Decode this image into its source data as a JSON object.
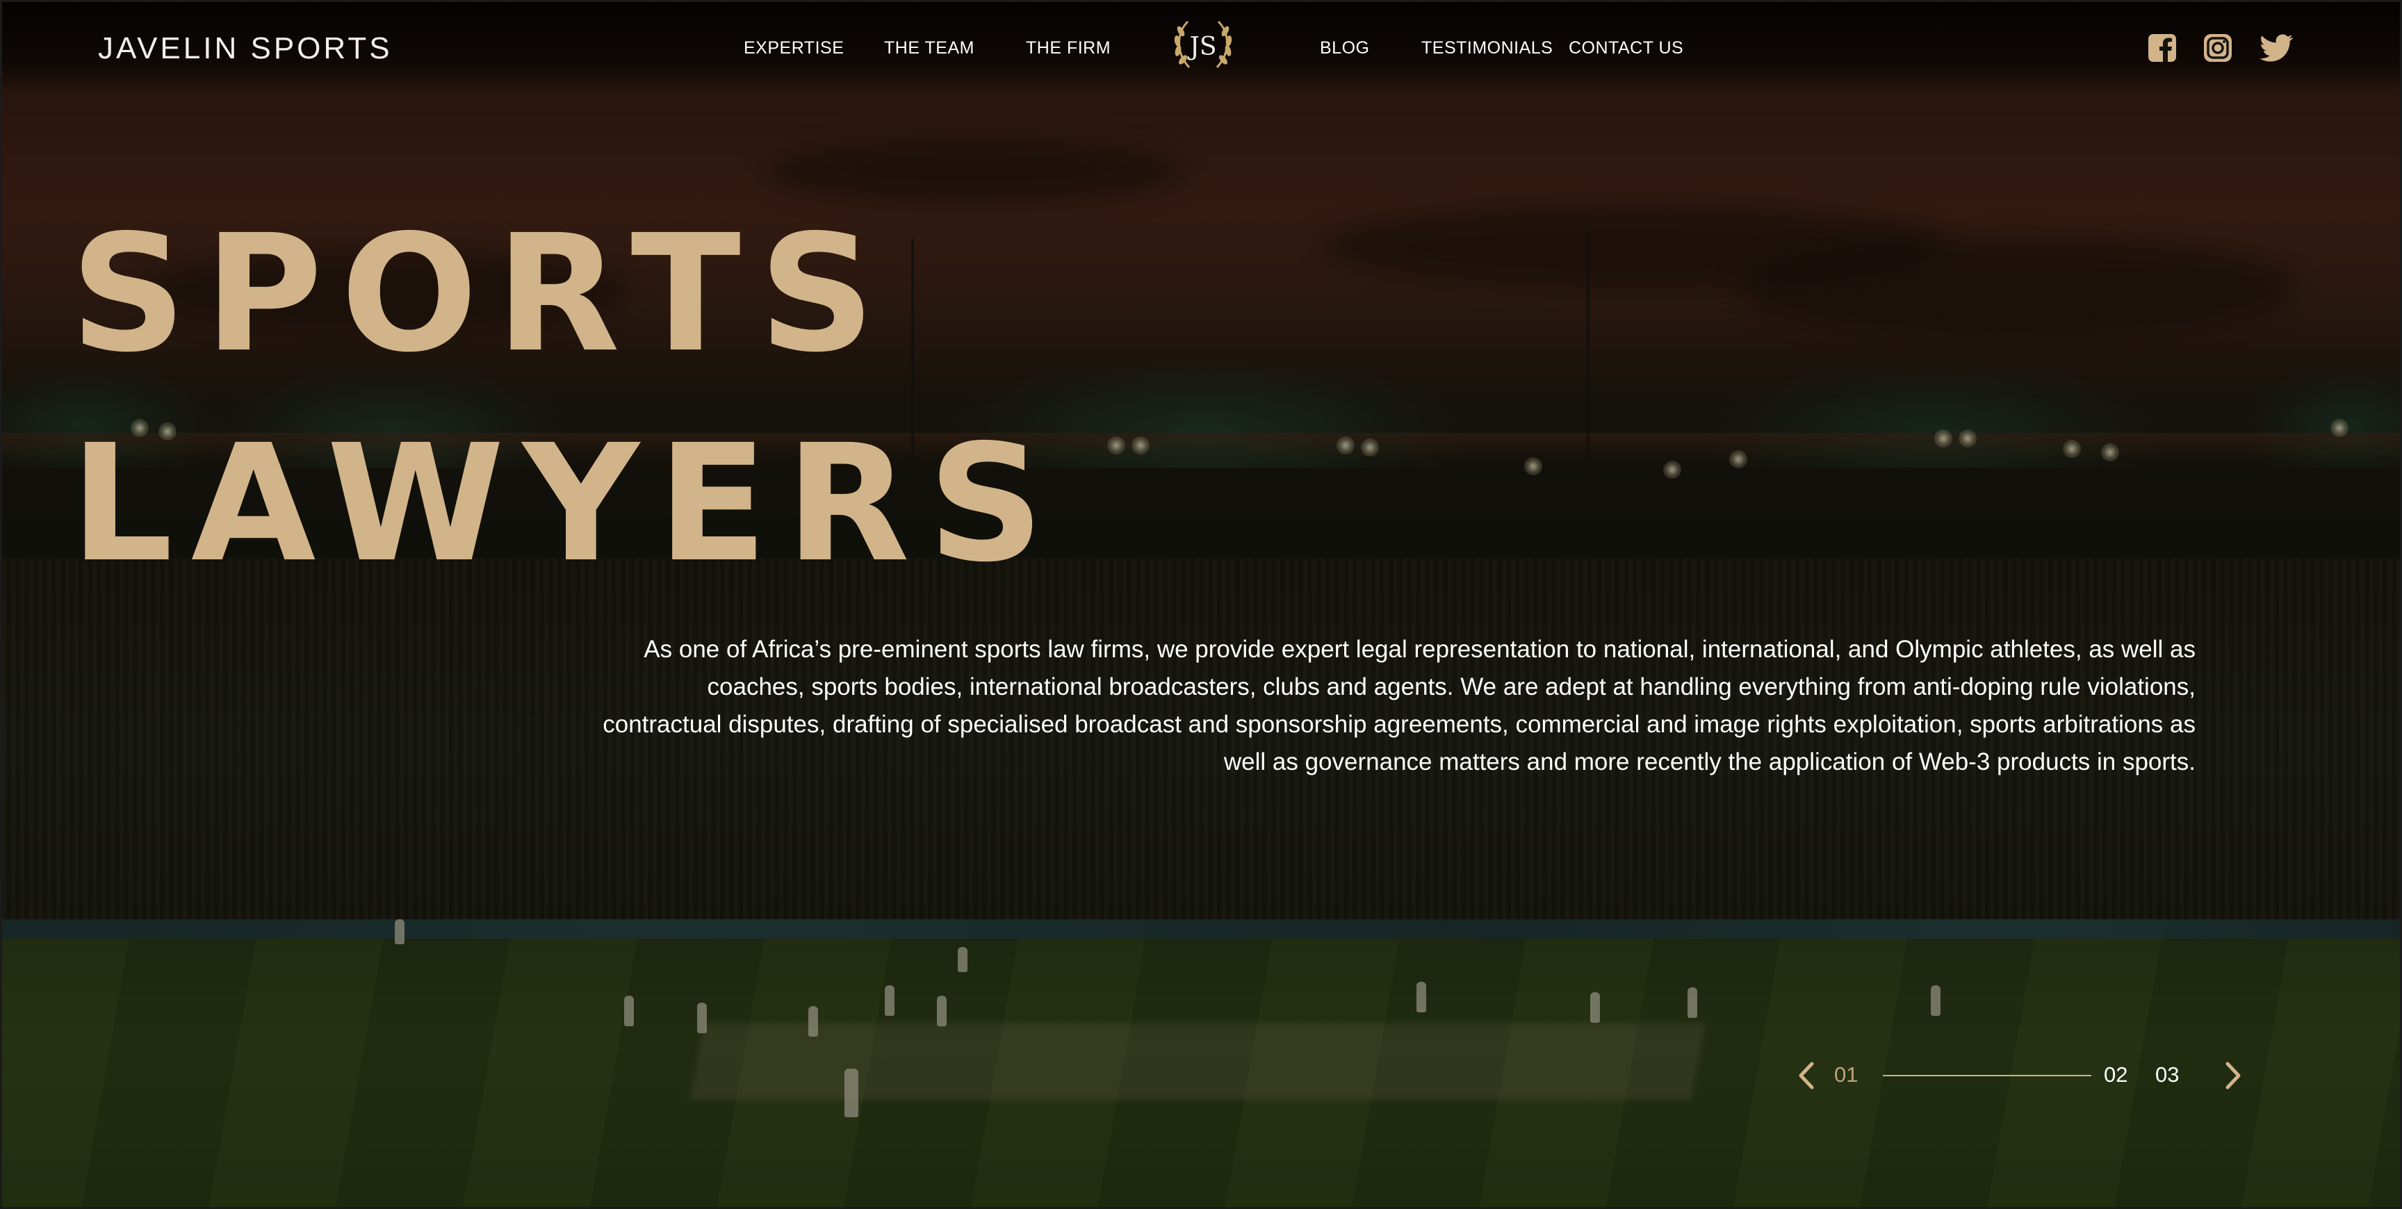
{
  "brand": {
    "name": "JAVELIN SPORTS",
    "logo_text": "JS"
  },
  "nav": {
    "left": [
      "EXPERTISE",
      "THE TEAM",
      "THE FIRM"
    ],
    "right": [
      "BLOG",
      "TESTIMONIALS",
      "CONTACT US"
    ]
  },
  "social": [
    "facebook-icon",
    "instagram-icon",
    "twitter-icon"
  ],
  "hero": {
    "title_line1": "SPORTS",
    "title_line2": "LAWYERS",
    "description": "As one of Africa’s pre-eminent sports law firms, we provide expert legal representation to national, international, and Olympic athletes, as well as coaches, sports bodies, international broadcasters, clubs and agents. We are adept at handling everything from anti-doping rule violations, contractual disputes, drafting of specialised broadcast and sponsorship agreements, commercial and image rights exploitation, sports arbitrations as well as governance matters and more recently the application of Web-3 products in sports."
  },
  "slider": {
    "slides": [
      "01",
      "02",
      "03"
    ],
    "active_index": 0
  },
  "colors": {
    "accent_gold": "#d2b48a",
    "active_slide": "#bfa47a",
    "text": "#ffffff"
  }
}
